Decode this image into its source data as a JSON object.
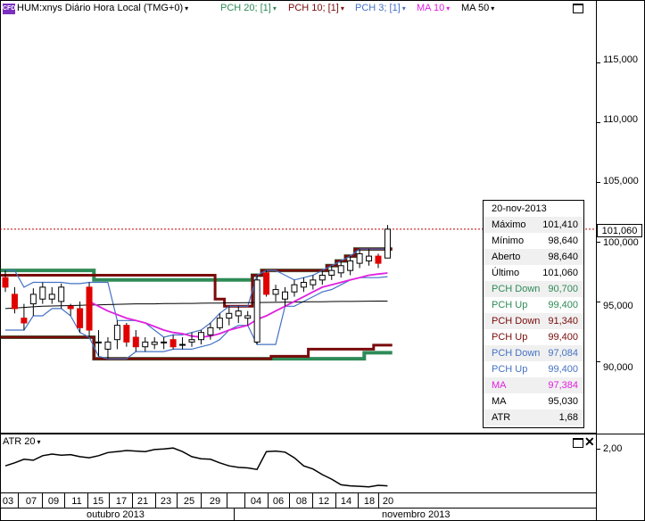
{
  "header": {
    "badge": "CFD",
    "symbol": "HUM:xnys Diário Hora Local (TMG+0)",
    "indicators": [
      {
        "label": "PCH 20; [1]",
        "color": "#2e8b57"
      },
      {
        "label": "PCH 10; [1]",
        "color": "#7a0a0a"
      },
      {
        "label": "PCH 3; [1]",
        "color": "#4472c4"
      },
      {
        "label": "MA 10",
        "color": "#e020e0"
      },
      {
        "label": "MA 50",
        "color": "#000000"
      }
    ],
    "caret": "▾"
  },
  "price_axis": {
    "labels": [
      "115,000",
      "110,000",
      "105,000",
      "100,000",
      "95,000",
      "90,000"
    ],
    "current_price": "101,060"
  },
  "tooltip": {
    "date": "20-nov-2013",
    "rows": [
      {
        "k": "Máximo",
        "v": "101,410",
        "color": "#000000"
      },
      {
        "k": "Mínimo",
        "v": "98,640",
        "color": "#000000"
      },
      {
        "k": "Aberto",
        "v": "98,640",
        "color": "#000000"
      },
      {
        "k": "Último",
        "v": "101,060",
        "color": "#000000"
      },
      {
        "k": "PCH Down",
        "v": "90,700",
        "color": "#2e8b57"
      },
      {
        "k": "PCH Up",
        "v": "99,400",
        "color": "#2e8b57"
      },
      {
        "k": "PCH Down",
        "v": "91,340",
        "color": "#7a0a0a"
      },
      {
        "k": "PCH Up",
        "v": "99,400",
        "color": "#7a0a0a"
      },
      {
        "k": "PCH Down",
        "v": "97,084",
        "color": "#4472c4"
      },
      {
        "k": "PCH Up",
        "v": "99,400",
        "color": "#4472c4"
      },
      {
        "k": "MA",
        "v": "97,384",
        "color": "#e020e0"
      },
      {
        "k": "MA",
        "v": "95,030",
        "color": "#000000"
      },
      {
        "k": "ATR",
        "v": "1,68",
        "color": "#000000"
      }
    ]
  },
  "sub_pane": {
    "title": "ATR 20",
    "axis_label": "2,00"
  },
  "x_axis": {
    "days": [
      "03",
      "07",
      "09",
      "11",
      "15",
      "17",
      "21",
      "23",
      "25",
      "29",
      "04",
      "06",
      "08",
      "12",
      "14",
      "18",
      "20"
    ],
    "months": [
      "outubro 2013",
      "novembro 2013"
    ]
  },
  "chart_data": {
    "type": "candlestick",
    "ylim": [
      84,
      119
    ],
    "candles": [
      {
        "o": 97.0,
        "h": 97.6,
        "l": 95.8,
        "c": 96.2
      },
      {
        "o": 95.6,
        "h": 96.2,
        "l": 94.0,
        "c": 94.4
      },
      {
        "o": 93.6,
        "h": 94.8,
        "l": 92.6,
        "c": 93.2
      },
      {
        "o": 94.8,
        "h": 96.1,
        "l": 93.8,
        "c": 95.6
      },
      {
        "o": 95.2,
        "h": 96.6,
        "l": 94.8,
        "c": 96.2
      },
      {
        "o": 95.2,
        "h": 96.2,
        "l": 94.8,
        "c": 95.6
      },
      {
        "o": 95.0,
        "h": 96.5,
        "l": 94.4,
        "c": 96.2
      },
      {
        "o": 94.6,
        "h": 94.8,
        "l": 93.8,
        "c": 94.4
      },
      {
        "o": 94.4,
        "h": 95.0,
        "l": 92.4,
        "c": 92.8
      },
      {
        "o": 96.2,
        "h": 96.6,
        "l": 92.0,
        "c": 92.6
      },
      {
        "o": 91.6,
        "h": 92.6,
        "l": 90.4,
        "c": 91.6
      },
      {
        "o": 91.0,
        "h": 92.0,
        "l": 90.2,
        "c": 91.6
      },
      {
        "o": 91.8,
        "h": 93.4,
        "l": 91.0,
        "c": 93.0
      },
      {
        "o": 93.0,
        "h": 93.2,
        "l": 91.2,
        "c": 91.6
      },
      {
        "o": 92.0,
        "h": 92.6,
        "l": 90.8,
        "c": 91.2
      },
      {
        "o": 91.2,
        "h": 92.0,
        "l": 90.8,
        "c": 91.6
      },
      {
        "o": 91.4,
        "h": 92.0,
        "l": 91.0,
        "c": 91.6
      },
      {
        "o": 91.6,
        "h": 92.0,
        "l": 91.0,
        "c": 91.6
      },
      {
        "o": 91.8,
        "h": 92.2,
        "l": 91.0,
        "c": 91.2
      },
      {
        "o": 91.4,
        "h": 92.0,
        "l": 91.0,
        "c": 91.4
      },
      {
        "o": 91.6,
        "h": 92.4,
        "l": 91.2,
        "c": 91.8
      },
      {
        "o": 91.8,
        "h": 92.6,
        "l": 91.4,
        "c": 92.4
      },
      {
        "o": 92.2,
        "h": 93.2,
        "l": 91.8,
        "c": 92.8
      },
      {
        "o": 92.8,
        "h": 94.0,
        "l": 92.6,
        "c": 93.6
      },
      {
        "o": 93.6,
        "h": 94.6,
        "l": 93.0,
        "c": 94.0
      },
      {
        "o": 93.8,
        "h": 94.6,
        "l": 93.2,
        "c": 94.2
      },
      {
        "o": 93.6,
        "h": 94.2,
        "l": 93.0,
        "c": 93.8
      },
      {
        "o": 91.6,
        "h": 97.2,
        "l": 91.4,
        "c": 96.8
      },
      {
        "o": 97.4,
        "h": 97.6,
        "l": 95.4,
        "c": 95.6
      },
      {
        "o": 95.6,
        "h": 96.4,
        "l": 95.0,
        "c": 96.0
      },
      {
        "o": 95.2,
        "h": 96.2,
        "l": 94.6,
        "c": 95.8
      },
      {
        "o": 95.8,
        "h": 96.8,
        "l": 95.4,
        "c": 96.4
      },
      {
        "o": 96.2,
        "h": 97.0,
        "l": 95.8,
        "c": 96.6
      },
      {
        "o": 96.4,
        "h": 97.2,
        "l": 96.0,
        "c": 96.8
      },
      {
        "o": 96.8,
        "h": 97.6,
        "l": 96.4,
        "c": 97.2
      },
      {
        "o": 97.2,
        "h": 98.0,
        "l": 96.8,
        "c": 97.6
      },
      {
        "o": 97.4,
        "h": 98.4,
        "l": 97.0,
        "c": 98.0
      },
      {
        "o": 97.6,
        "h": 98.8,
        "l": 97.2,
        "c": 98.4
      },
      {
        "o": 98.2,
        "h": 99.4,
        "l": 97.8,
        "c": 99.0
      },
      {
        "o": 98.4,
        "h": 99.4,
        "l": 98.0,
        "c": 98.8
      },
      {
        "o": 98.8,
        "h": 99.0,
        "l": 97.8,
        "c": 98.2
      },
      {
        "o": 98.64,
        "h": 101.41,
        "l": 98.64,
        "c": 101.06
      }
    ],
    "series": [
      {
        "name": "PCH 20 Up",
        "color": "#2e8b57",
        "values": [
          97.6,
          97.6,
          97.6,
          97.6,
          97.6,
          97.6,
          97.6,
          97.6,
          97.6,
          97.6,
          96.8,
          96.8,
          96.8,
          96.8,
          96.8,
          96.8,
          96.8,
          96.8,
          96.8,
          96.8,
          96.8,
          96.8,
          96.8,
          96.8,
          96.8,
          96.8,
          96.8,
          97.2,
          97.6,
          97.6,
          97.6,
          97.6,
          97.6,
          97.6,
          97.6,
          98.0,
          98.4,
          98.8,
          99.4,
          99.4,
          99.4,
          99.4
        ]
      },
      {
        "name": "PCH 20 Down",
        "color": "#2e8b57",
        "values": [
          92.0,
          92.0,
          92.0,
          92.0,
          92.0,
          92.0,
          92.0,
          92.0,
          92.0,
          92.0,
          90.2,
          90.2,
          90.2,
          90.2,
          90.2,
          90.2,
          90.2,
          90.2,
          90.2,
          90.2,
          90.2,
          90.2,
          90.2,
          90.2,
          90.2,
          90.2,
          90.2,
          90.2,
          90.2,
          90.2,
          90.2,
          90.2,
          90.2,
          90.2,
          90.2,
          90.2,
          90.2,
          90.2,
          90.2,
          90.7,
          90.7,
          90.7
        ]
      },
      {
        "name": "PCH 10 Up",
        "color": "#7a0a0a",
        "values": [
          97.2,
          97.2,
          97.2,
          97.2,
          97.2,
          97.2,
          97.2,
          97.2,
          97.2,
          97.2,
          97.2,
          97.2,
          97.2,
          97.2,
          97.2,
          97.2,
          97.2,
          97.2,
          97.2,
          97.2,
          97.2,
          97.2,
          97.2,
          95.2,
          94.6,
          94.6,
          94.6,
          97.2,
          97.6,
          97.6,
          97.6,
          97.6,
          97.6,
          97.6,
          97.6,
          98.0,
          98.4,
          98.8,
          99.4,
          99.4,
          99.4,
          99.4
        ]
      },
      {
        "name": "PCH 10 Down",
        "color": "#7a0a0a",
        "values": [
          92.0,
          92.0,
          92.0,
          92.0,
          92.0,
          92.0,
          92.0,
          92.0,
          92.0,
          92.0,
          90.2,
          90.2,
          90.2,
          90.2,
          90.2,
          90.2,
          90.2,
          90.2,
          90.2,
          90.2,
          90.2,
          90.2,
          90.2,
          90.2,
          90.2,
          90.2,
          90.2,
          90.2,
          90.2,
          90.4,
          90.4,
          90.4,
          90.4,
          91.0,
          91.0,
          91.0,
          91.0,
          91.0,
          91.0,
          91.0,
          91.34,
          91.34
        ]
      },
      {
        "name": "PCH 3 Up",
        "color": "#4472c4",
        "values": [
          97.6,
          97.6,
          96.2,
          96.6,
          96.6,
          96.6,
          96.6,
          96.5,
          96.5,
          96.6,
          96.6,
          96.6,
          93.4,
          93.4,
          93.4,
          93.2,
          92.6,
          92.0,
          92.2,
          92.2,
          92.4,
          92.6,
          93.2,
          94.0,
          94.6,
          94.6,
          94.6,
          97.2,
          97.6,
          97.6,
          97.2,
          96.8,
          97.0,
          97.2,
          97.6,
          98.0,
          98.4,
          98.8,
          99.4,
          99.4,
          99.4,
          99.4
        ]
      },
      {
        "name": "PCH 3 Down",
        "color": "#4472c4",
        "values": [
          92.6,
          92.6,
          92.6,
          93.8,
          93.8,
          94.4,
          94.4,
          93.8,
          92.4,
          92.0,
          90.4,
          90.2,
          90.2,
          90.2,
          90.8,
          90.8,
          90.8,
          90.8,
          91.0,
          91.0,
          91.0,
          91.2,
          91.4,
          91.8,
          92.6,
          93.0,
          93.0,
          91.4,
          91.4,
          91.4,
          94.6,
          94.6,
          95.0,
          95.4,
          95.8,
          96.0,
          96.4,
          96.8,
          97.0,
          97.0,
          97.0,
          97.08
        ]
      },
      {
        "name": "MA 10",
        "color": "#e020e0",
        "values": [
          null,
          null,
          null,
          null,
          null,
          null,
          null,
          null,
          null,
          95.0,
          94.6,
          94.2,
          93.9,
          93.6,
          93.4,
          93.2,
          92.9,
          92.6,
          92.4,
          92.3,
          92.1,
          92.0,
          92.1,
          92.3,
          92.6,
          92.8,
          93.0,
          93.5,
          93.8,
          94.2,
          94.6,
          95.0,
          95.4,
          95.8,
          96.2,
          96.4,
          96.6,
          96.8,
          97.0,
          97.2,
          97.3,
          97.384
        ]
      },
      {
        "name": "MA 50",
        "color": "#000000",
        "values": [
          94.4,
          94.45,
          94.5,
          94.55,
          94.6,
          94.62,
          94.64,
          94.66,
          94.68,
          94.7,
          94.72,
          94.74,
          94.76,
          94.78,
          94.8,
          94.8,
          94.8,
          94.82,
          94.82,
          94.84,
          94.84,
          94.85,
          94.86,
          94.87,
          94.88,
          94.89,
          94.9,
          94.91,
          94.92,
          94.93,
          94.94,
          94.95,
          94.96,
          94.97,
          94.98,
          94.99,
          95.0,
          95.0,
          95.01,
          95.02,
          95.03,
          95.03
        ]
      }
    ],
    "atr": {
      "ylim": [
        1.3,
        2.4
      ],
      "values": [
        1.82,
        1.88,
        1.95,
        1.93,
        2.02,
        2.05,
        2.03,
        2.04,
        2.0,
        1.98,
        2.02,
        2.08,
        2.1,
        2.12,
        2.11,
        2.1,
        2.14,
        2.15,
        2.17,
        2.1,
        2.0,
        1.96,
        1.95,
        1.88,
        1.82,
        1.79,
        1.78,
        1.75,
        2.1,
        2.11,
        2.09,
        1.98,
        1.82,
        1.76,
        1.65,
        1.56,
        1.45,
        1.43,
        1.42,
        1.41,
        1.44,
        1.43
      ]
    }
  }
}
